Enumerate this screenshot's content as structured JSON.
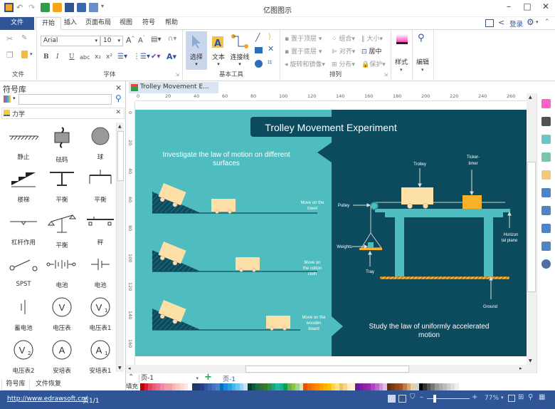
{
  "app": {
    "title": "亿图图示"
  },
  "quick_access": [
    "app-menu-icon",
    "undo-icon",
    "redo-icon",
    "new-icon",
    "open-icon",
    "save-icon",
    "print-icon",
    "export-icon",
    "customize-icon"
  ],
  "menu": {
    "file": "文件",
    "tabs": [
      "开始",
      "插入",
      "页面布局",
      "视图",
      "符号",
      "帮助"
    ],
    "active_tab": "开始",
    "right": {
      "login": "登录"
    }
  },
  "ribbon": {
    "file_group": {
      "label": "文件"
    },
    "font_group": {
      "label": "字体",
      "font": "Arial",
      "size": "10",
      "buttons": [
        "B",
        "I",
        "U",
        "abc",
        "x₂",
        "x²"
      ]
    },
    "basic_tools": {
      "label": "基本工具",
      "select": "选择",
      "text": "文本",
      "connector": "连接线"
    },
    "arrange": {
      "label": "排列",
      "items": [
        "置于顶层",
        "置于底层",
        "旋转和镜像",
        "组合",
        "对齐",
        "分布",
        "大小",
        "居中",
        "保护"
      ]
    },
    "style": {
      "label": "样式"
    },
    "edit": {
      "label": "编辑"
    }
  },
  "library": {
    "title": "符号库",
    "search_placeholder": "",
    "category": "力学",
    "symbols": [
      "静止",
      "砝码",
      "球",
      "楼梯",
      "平衡",
      "平衡",
      "杠杆作用",
      "平衡",
      "秤",
      "SPST",
      "电池",
      "电池",
      "蓄电池",
      "电压表",
      "电压表1",
      "电压表2",
      "安培表",
      "安培表1"
    ],
    "bottom_tabs": [
      "符号库",
      "文件恢复"
    ]
  },
  "document": {
    "tab_title": "Trolley Movement E...",
    "hruler": [
      "0",
      "20",
      "40",
      "60",
      "80",
      "100",
      "120",
      "140",
      "160",
      "180",
      "200",
      "220",
      "240",
      "260"
    ],
    "vruler": [
      "0",
      "20",
      "40",
      "60",
      "80",
      "100",
      "120",
      "140",
      "160"
    ]
  },
  "diagram": {
    "title": "Trolley Movement Experiment",
    "left_heading": "Investigate the law of motion on different surfaces",
    "surfaces": [
      "Move on the towel",
      "Move on the cotton cloth",
      "Move on the wooden board"
    ],
    "right_heading": "Study the law of uniformly accelerated motion",
    "labels": {
      "trolley": "Trolley",
      "ticker": "Ticker-timer",
      "pulley": "Pulley",
      "weights": "Weights",
      "tray": "Tray",
      "horizontal": "Horizontal plane",
      "ground": "Ground"
    },
    "colors": {
      "teal": "#4fbdbf",
      "dark": "#0c4a5e",
      "cart": "#fde0a8",
      "ticker": "#f7b22a"
    }
  },
  "pagebar": {
    "page_select": "页-1",
    "page_tab": "页-1",
    "fill_label": "填充"
  },
  "status": {
    "url": "http://www.edrawsoft.cn/",
    "page": "页1/1",
    "zoom": "77%"
  }
}
